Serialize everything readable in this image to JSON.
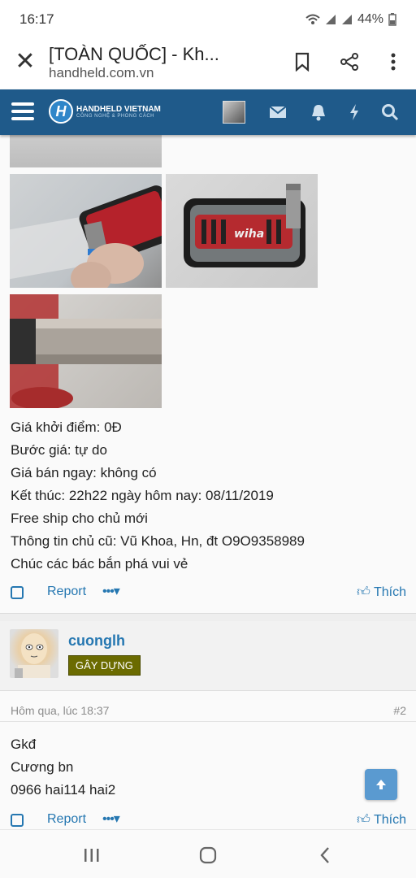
{
  "status_bar": {
    "time": "16:17",
    "battery": "44%"
  },
  "browser": {
    "title": "[TOÀN QUỐC] - Kh...",
    "url": "handheld.com.vn"
  },
  "site": {
    "logo_title": "HANDHELD VIETNAM",
    "logo_subtitle": "CÔNG NGHỆ & PHONG CÁCH",
    "logo_letter": "H"
  },
  "post1": {
    "lines": [
      "Giá khởi điểm: 0Đ",
      "Bước giá: tự do",
      "Giá bán ngay: không có",
      "Kết thúc: 22h22 ngày hôm nay: 08/11/2019",
      "Free ship cho chủ mới",
      "Thông tin chủ cũ: Vũ Khoa, Hn, đt O9O9358989",
      "Chúc các bác bắn phá vui vẻ"
    ],
    "report_label": "Report",
    "more_label": "•••▾",
    "like_label": "Thích"
  },
  "post2": {
    "username": "cuonglh",
    "badge": "GÂY DỰNG",
    "date": "Hôm qua, lúc 18:37",
    "number": "#2",
    "lines": [
      "Gkđ",
      "Cương bn",
      "0966 hai114 hai2"
    ],
    "report_label": "Report",
    "more_label": "•••▾",
    "like_label": "Thích"
  },
  "photo_text": "wiha"
}
